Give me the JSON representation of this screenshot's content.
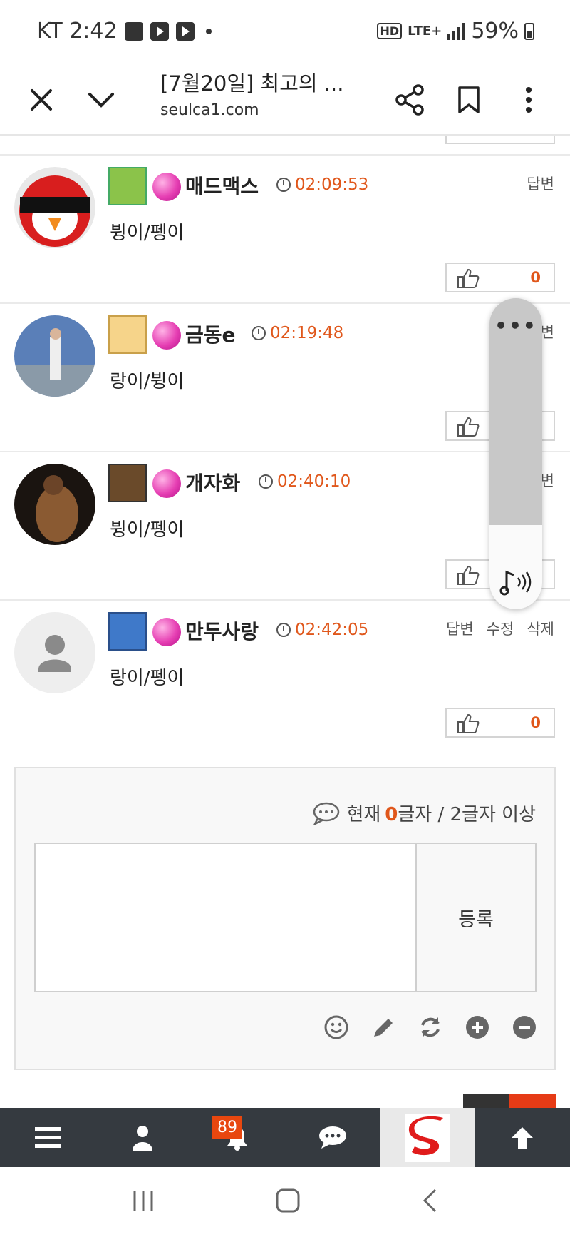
{
  "status_bar": {
    "carrier_time": "KT 2:42",
    "hd": "HD",
    "network": "LTE+",
    "battery": "59%"
  },
  "browser": {
    "title": "[7월20일] 최고의 ...",
    "url": "seulca1.com",
    "icons": [
      "close-icon",
      "chevron-down-icon",
      "share-icon",
      "bookmark-icon",
      "more-vertical-icon"
    ]
  },
  "comments": [
    {
      "nickname": "매드맥스",
      "time": "02:09:53",
      "text": "뷩이/펭이",
      "actions": [
        "답변"
      ],
      "likes": "0"
    },
    {
      "nickname": "금동e",
      "time": "02:19:48",
      "text": "랑이/뷩이",
      "actions": [
        "변"
      ],
      "likes": "0"
    },
    {
      "nickname": "개자화",
      "time": "02:40:10",
      "text": "뷩이/펭이",
      "actions": [
        "변"
      ],
      "likes": "0"
    },
    {
      "nickname": "만두사랑",
      "time": "02:42:05",
      "text": "랑이/펭이",
      "actions": [
        "답변",
        "수정",
        "삭제"
      ],
      "likes": "0"
    }
  ],
  "volume_panel": {
    "dots": "•••",
    "level": 0.27
  },
  "comment_form": {
    "counter_prefix": "현재",
    "count": "0",
    "counter_suffix": "글자 / 2글자 이상",
    "submit_label": "등록",
    "tools": [
      "emoji-icon",
      "pencil-icon",
      "refresh-icon",
      "plus-circle-icon",
      "minus-circle-icon"
    ]
  },
  "bottom_nav": {
    "items": [
      "menu-icon",
      "user-icon",
      "bell-icon",
      "chat-icon",
      "logo",
      "arrow-up-icon"
    ],
    "badge": "89"
  },
  "colors": {
    "accent": "#e0571b",
    "nav_bg": "#353a40",
    "badge": "#e8470f"
  }
}
